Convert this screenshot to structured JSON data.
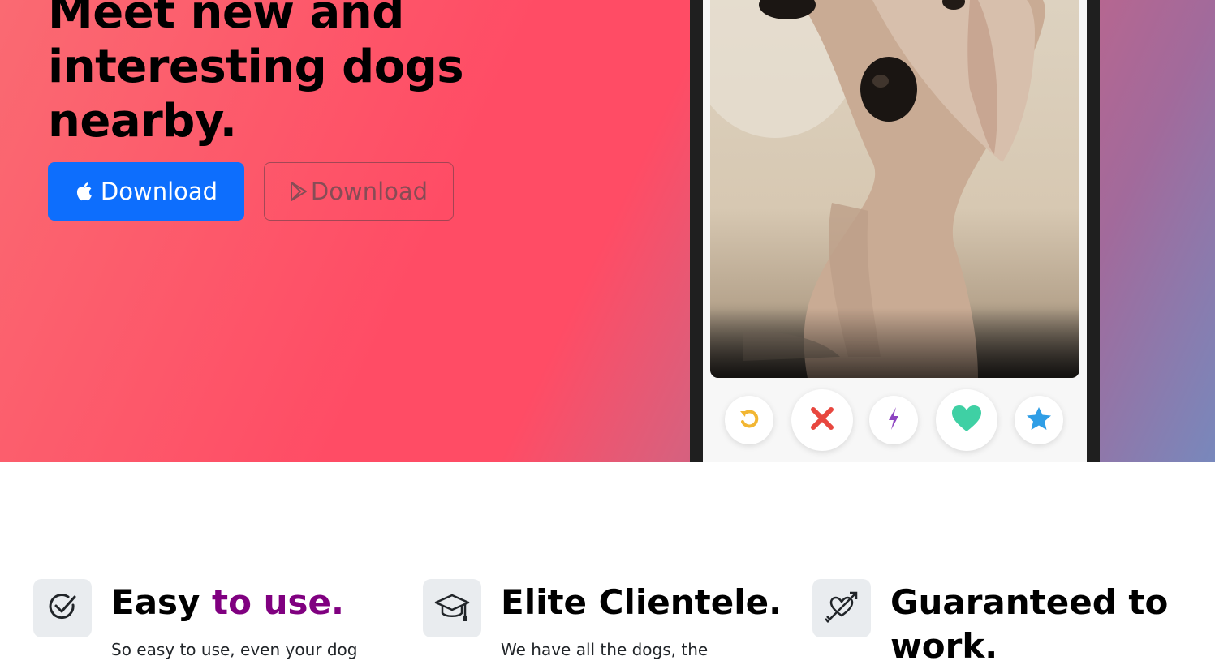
{
  "hero": {
    "title": "Meet new and interesting dogs nearby.",
    "apple_button_label": "Download",
    "play_button_label": "Download"
  },
  "phone": {
    "actions": [
      "rewind-icon",
      "nope-icon",
      "boost-icon",
      "like-icon",
      "super-like-icon"
    ]
  },
  "features": [
    {
      "icon": "check-circle-icon",
      "title_main": "Easy ",
      "title_accent": "to use.",
      "text": "So easy to use, even your dog"
    },
    {
      "icon": "graduation-cap-icon",
      "title_main": "Elite Clientele.",
      "text": "We have all the dogs, the"
    },
    {
      "icon": "heart-arrow-icon",
      "title_main": "Guaranteed to work.",
      "text": ""
    }
  ],
  "colors": {
    "hero_pink": "#ff4c65",
    "hero_blue": "#7888bc",
    "primary_button": "#0d6efd",
    "accent_purple": "#800080",
    "icon_box": "#e9ecef"
  }
}
